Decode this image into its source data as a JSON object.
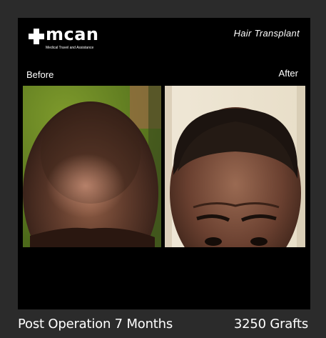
{
  "brand": {
    "name": "mcan",
    "tagline": "Medical Travel and Assistance"
  },
  "service": "Hair Transplant",
  "labels": {
    "before": "Before",
    "after": "After"
  },
  "caption": {
    "duration": "Post Operation 7 Months",
    "grafts": "3250 Grafts"
  },
  "colors": {
    "page_background": "#2b2b2b",
    "card_background": "#000000",
    "text": "#ffffff"
  }
}
